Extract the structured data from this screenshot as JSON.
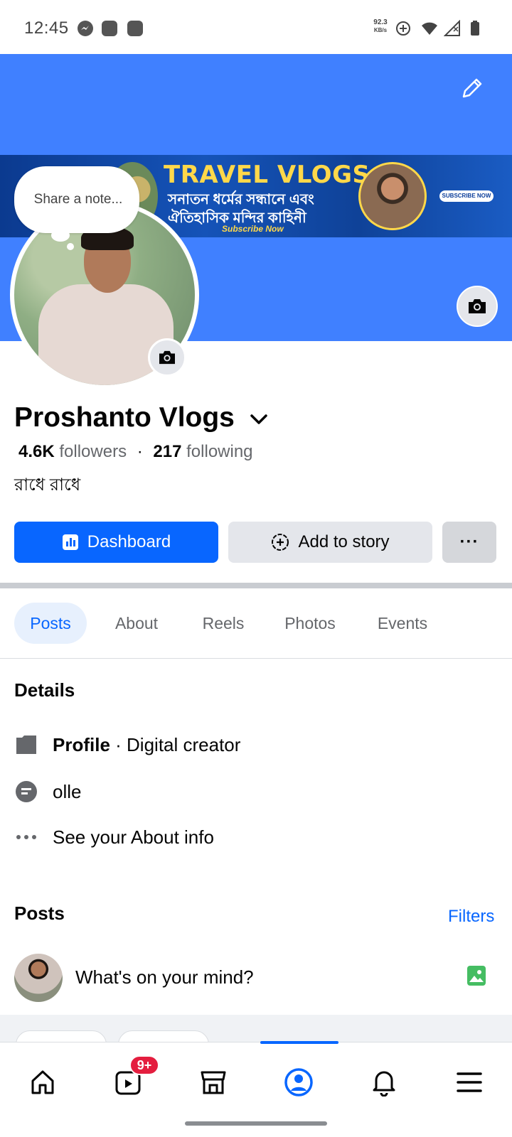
{
  "status_bar": {
    "time": "12:45",
    "net_speed_value": "92.3",
    "net_speed_unit": "KB/s",
    "icons": [
      "messenger-icon",
      "app-icon",
      "app-icon",
      "data-saver-icon",
      "wifi-icon",
      "signal-icon",
      "battery-icon"
    ]
  },
  "cover": {
    "banner_title": "TRAVEL VLOGS",
    "banner_line1": "সনাতন ধর্মের সন্ধানে এবং",
    "banner_line2": "ঐতিহাসিক মন্দির কাহিনী",
    "banner_cta": "Subscribe Now",
    "banner_button": "SUBSCRIBE NOW"
  },
  "note": {
    "placeholder": "Share a note..."
  },
  "profile": {
    "name": "Proshanto Vlogs",
    "followers_count": "4.6K",
    "followers_label": "followers",
    "following_count": "217",
    "following_label": "following",
    "separator": "·",
    "bio": "রাধে রাধে"
  },
  "actions": {
    "dashboard_label": "Dashboard",
    "add_story_label": "Add to story",
    "more_label": "···"
  },
  "tabs": [
    {
      "label": "Posts",
      "active": true
    },
    {
      "label": "About",
      "active": false
    },
    {
      "label": "Reels",
      "active": false
    },
    {
      "label": "Photos",
      "active": false
    },
    {
      "label": "Events",
      "active": false
    }
  ],
  "details": {
    "title": "Details",
    "profile_label": "Profile",
    "profile_type": " · Digital creator",
    "other_item": "olle",
    "see_about": "See your About info"
  },
  "posts": {
    "title": "Posts",
    "filters_label": "Filters",
    "composer_placeholder": "What's on your mind?"
  },
  "bottom_nav": {
    "items": [
      "home-icon",
      "video-icon",
      "marketplace-icon",
      "profile-icon",
      "notifications-icon",
      "menu-icon"
    ],
    "video_badge": "9+",
    "active": "profile-icon"
  },
  "colors": {
    "accent": "#0866ff",
    "cover": "#4080ff",
    "badge": "#e41e3f",
    "secondary_text": "#65676b"
  }
}
